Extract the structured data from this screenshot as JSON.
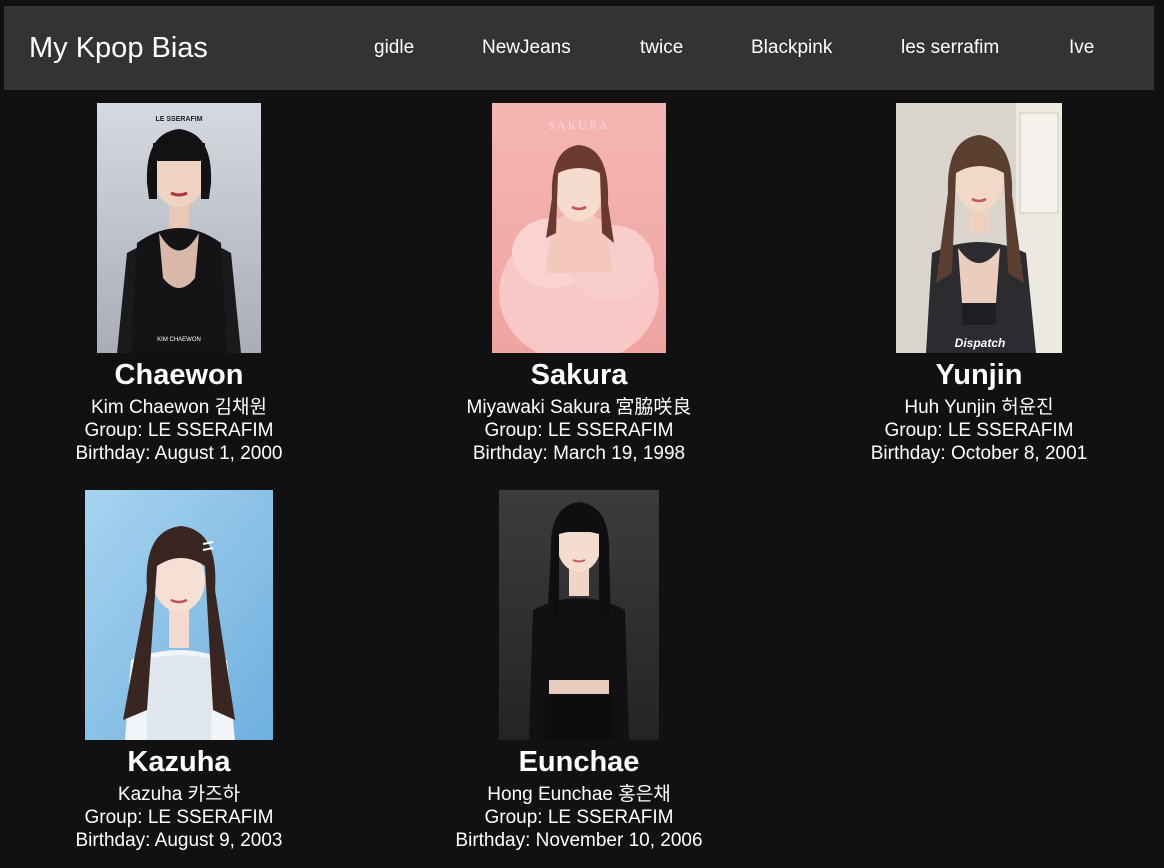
{
  "header": {
    "brand": "My Kpop Bias",
    "links": [
      "gidle",
      "NewJeans",
      "twice",
      "Blackpink",
      "les serrafim",
      "Ive"
    ]
  },
  "cards": [
    {
      "name": "Chaewon",
      "fullname": "Kim Chaewon 김채원",
      "group": "Group: LE SSERAFIM",
      "birthday": "Birthday: August 1, 2000",
      "photo_top_text": "LE SSERAFIM",
      "photo_bottom_text": "KIM CHAEWON"
    },
    {
      "name": "Sakura",
      "fullname": "Miyawaki Sakura 宮脇咲良",
      "group": "Group: LE SSERAFIM",
      "birthday": "Birthday: March 19, 1998",
      "photo_top_text": "SAKURA"
    },
    {
      "name": "Yunjin",
      "fullname": "Huh Yunjin 허윤진",
      "group": "Group: LE SSERAFIM",
      "birthday": "Birthday: October 8, 2001",
      "photo_watermark": "Dispatch"
    },
    {
      "name": "Kazuha",
      "fullname": "Kazuha 카즈하",
      "group": "Group: LE SSERAFIM",
      "birthday": "Birthday: August 9, 2003"
    },
    {
      "name": "Eunchae",
      "fullname": "Hong Eunchae 홍은채",
      "group": "Group: LE SSERAFIM",
      "birthday": "Birthday: November 10, 2006"
    }
  ],
  "colors": {
    "page_background": "#111111",
    "navbar_background": "#333333",
    "text": "#ffffff"
  }
}
